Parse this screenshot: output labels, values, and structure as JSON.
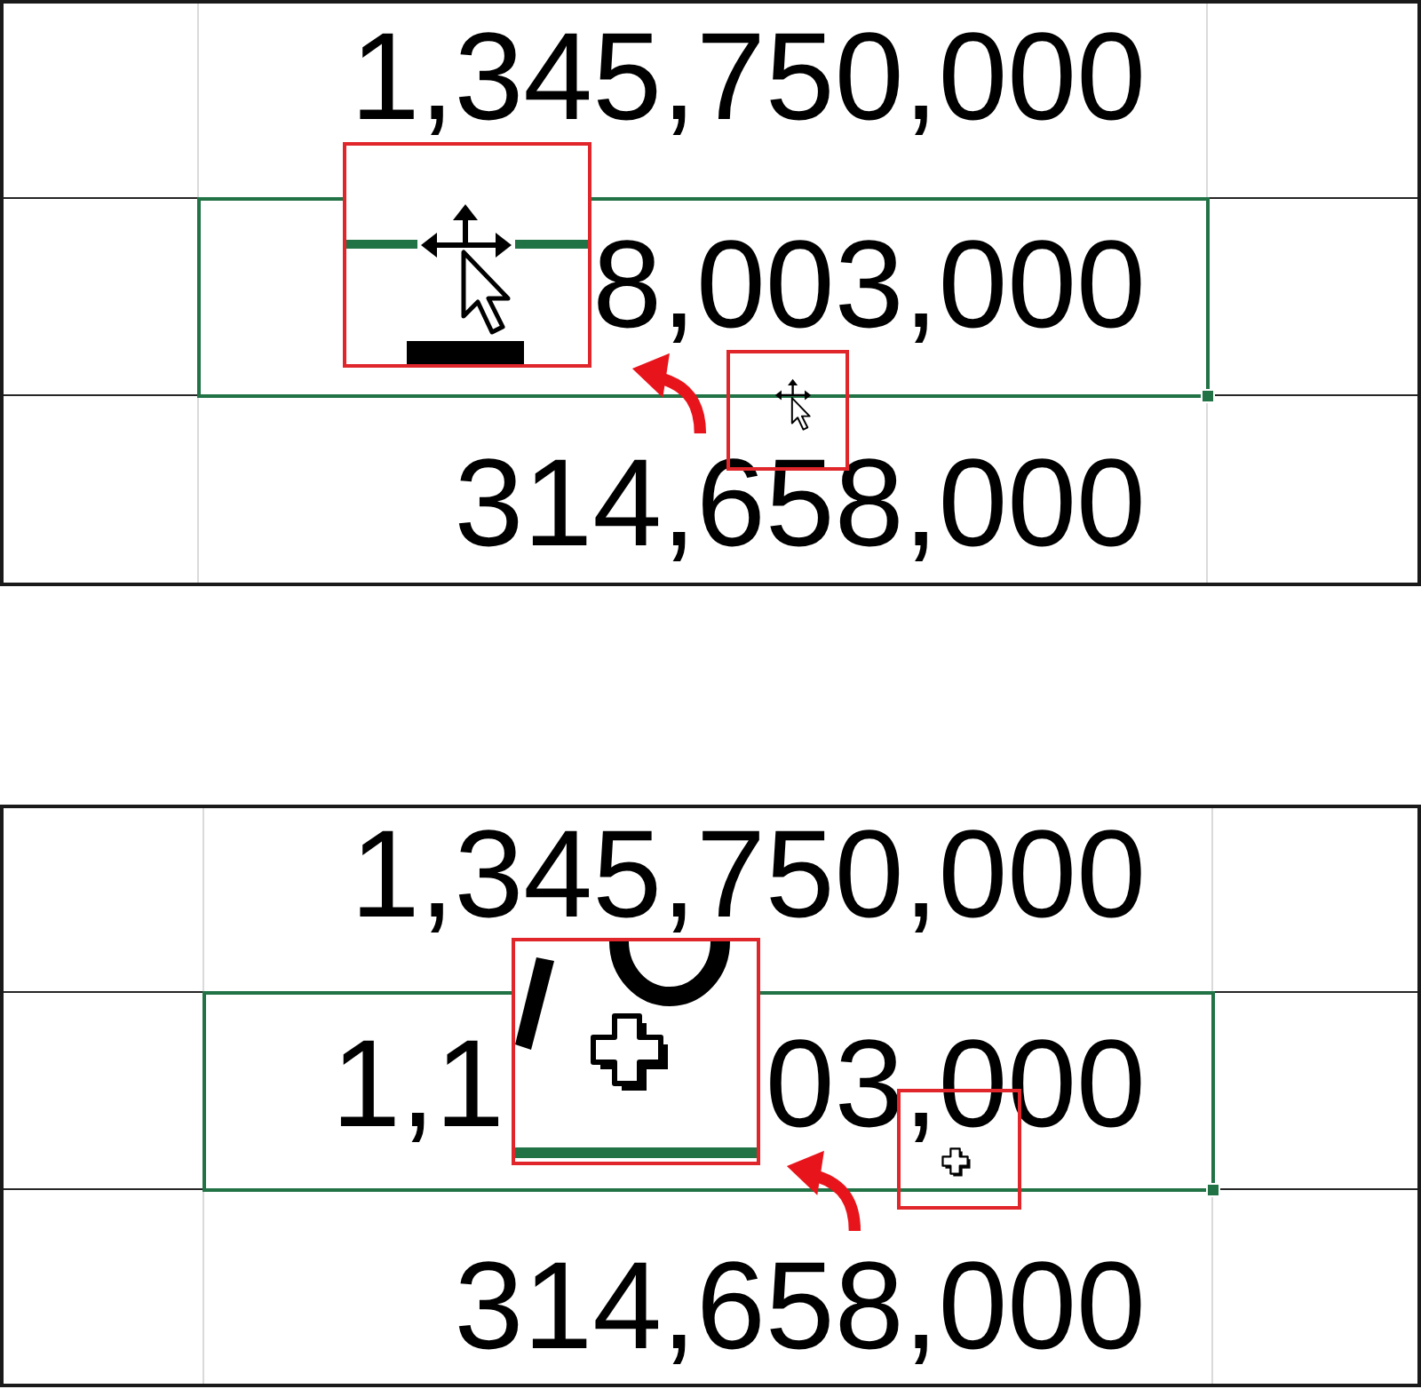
{
  "panels": [
    {
      "kind": "move",
      "rows": [
        {
          "selected": false,
          "text_parts": [
            "1,345,750,000"
          ]
        },
        {
          "selected": true,
          "text_parts": [
            "8,003,000"
          ]
        },
        {
          "selected": false,
          "text_parts": [
            "314,658,000"
          ]
        }
      ]
    },
    {
      "kind": "plus",
      "rows": [
        {
          "selected": false,
          "text_parts": [
            "1,345,750,000"
          ]
        },
        {
          "selected": true,
          "text_parts": [
            "1,1",
            "03,000"
          ]
        },
        {
          "selected": false,
          "text_parts": [
            "314,658,000"
          ]
        }
      ]
    }
  ]
}
